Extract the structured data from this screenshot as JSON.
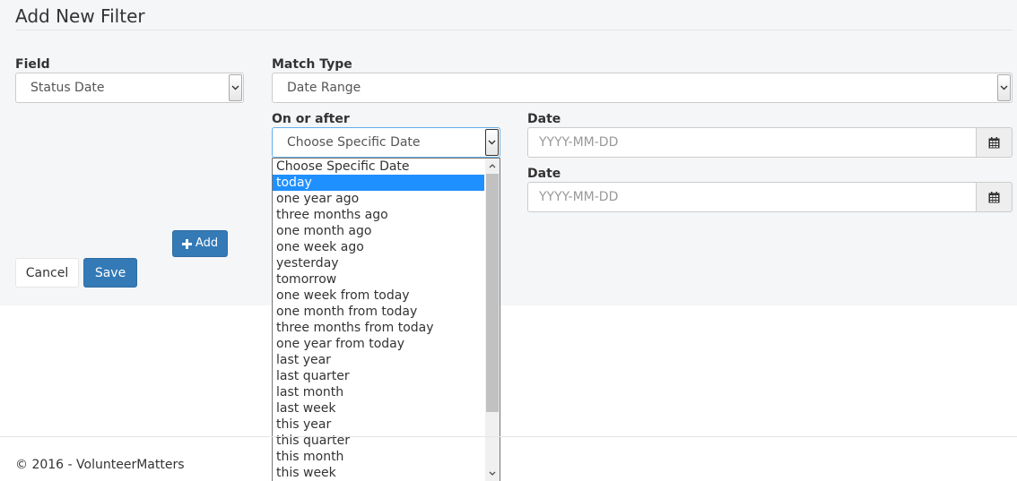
{
  "page": {
    "title": "Add New Filter"
  },
  "field": {
    "label": "Field",
    "value": "Status Date"
  },
  "match_type": {
    "label": "Match Type",
    "value": "Date Range"
  },
  "on_or_after": {
    "label": "On or after",
    "value": "Choose Specific Date",
    "options": [
      "Choose Specific Date",
      "today",
      "one year ago",
      "three months ago",
      "one month ago",
      "one week ago",
      "yesterday",
      "tomorrow",
      "one week from today",
      "one month from today",
      "three months from today",
      "one year from today",
      "last year",
      "last quarter",
      "last month",
      "last week",
      "this year",
      "this quarter",
      "this month",
      "this week"
    ],
    "highlighted_option": "today"
  },
  "date_start": {
    "label": "Date",
    "placeholder": "YYYY-MM-DD",
    "icon": "calendar-icon"
  },
  "date_end": {
    "label": "Date",
    "placeholder": "YYYY-MM-DD",
    "icon": "calendar-icon"
  },
  "buttons": {
    "add": "Add",
    "add_icon": "plus-icon",
    "cancel": "Cancel",
    "save": "Save"
  },
  "footer": {
    "copyright": "© 2016 - VolunteerMatters"
  },
  "colors": {
    "primary": "#337ab7",
    "highlight": "#1e90ff",
    "panel_bg": "#f5f6f8"
  }
}
